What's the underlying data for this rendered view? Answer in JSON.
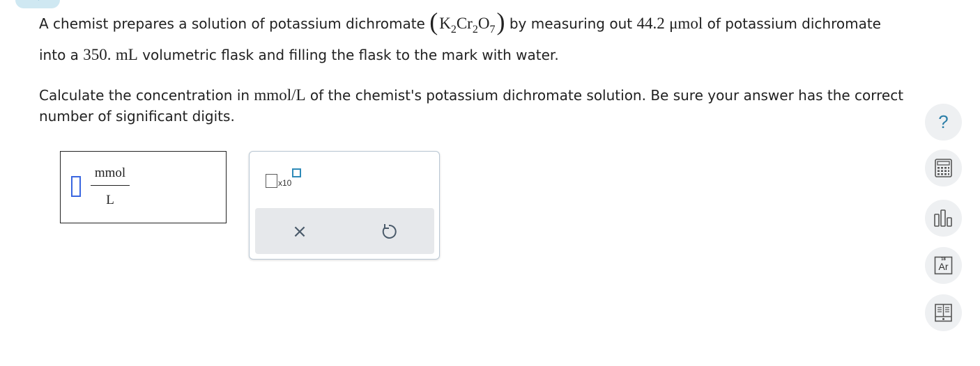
{
  "question": {
    "line1_a": "A chemist prepares a solution of potassium dichromate",
    "formula": {
      "k": "K",
      "k_sub": "2",
      "cr": "Cr",
      "cr_sub": "2",
      "o": "O",
      "o_sub": "7"
    },
    "line1_b": "by measuring out",
    "amount_value": "44.2",
    "amount_unit": "μmol",
    "line1_c": "of potassium dichromate",
    "line2_a": "into a",
    "volume_value": "350.",
    "volume_unit": "mL",
    "line2_b": "volumetric flask and filling the flask to the mark with water.",
    "line3_a": "Calculate the concentration in",
    "conc_unit": "mmol/L",
    "line3_b": "of the chemist's potassium dichromate solution. Be sure your answer has the correct",
    "line4": "number of significant digits."
  },
  "answer": {
    "value": "",
    "unit_numerator": "mmol",
    "unit_denominator": "L"
  },
  "palette": {
    "sci_notation_label": "x10",
    "clear_symbol": "×"
  },
  "sidebar": {
    "help_label": "?",
    "periodic_element_number": "18",
    "periodic_element_symbol": "Ar"
  },
  "colors": {
    "accent": "#2e8ab8",
    "input_border": "#3a66e0",
    "button_bg": "#eef0f2"
  }
}
